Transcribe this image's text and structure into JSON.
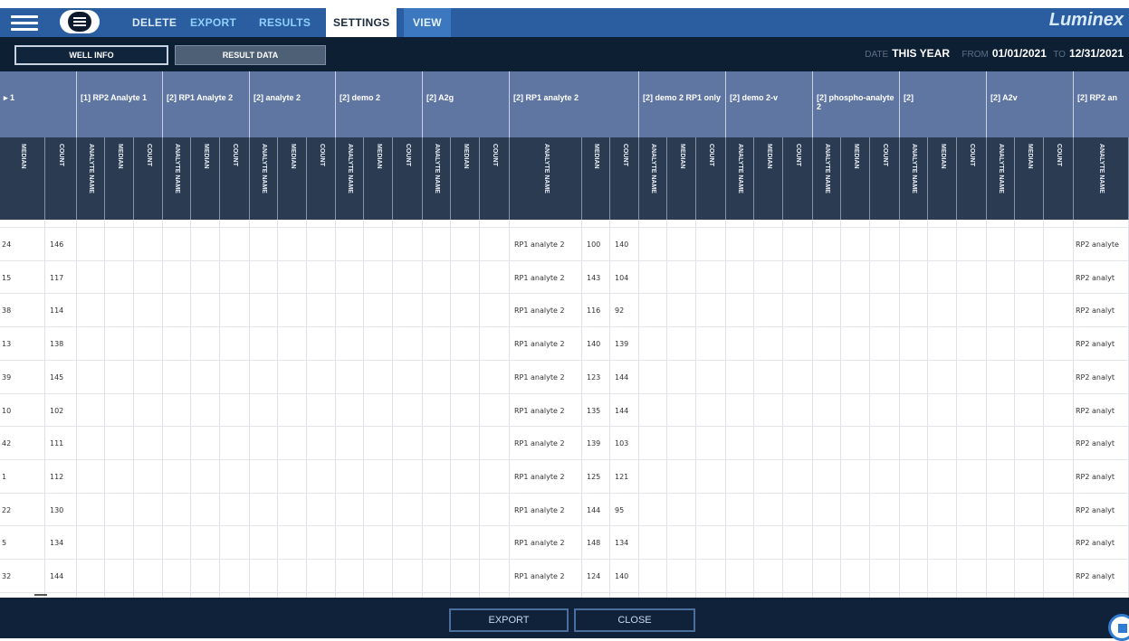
{
  "header_text": "",
  "nav": {
    "delete": "DELETE",
    "export": "EXPORT",
    "results": "RESULTS",
    "settings": "SETTINGS",
    "view": "VIEW"
  },
  "brand": "Luminex",
  "subnav": {
    "well_info": "WELL INFO",
    "result_data": "RESULT DATA"
  },
  "date": {
    "label": "DATE",
    "value": "THIS YEAR",
    "from_label": "FROM",
    "from": "01/01/2021",
    "to_label": "TO",
    "to": "12/31/2021"
  },
  "table": {
    "groups": [
      "▸ 1",
      "[1] RP2 Analyte 1",
      "[2] RP1 Analyte 2",
      "[2] analyte 2",
      "[2] demo 2",
      "[2] A2g",
      "[2] RP1 analyte 2",
      "[2] demo 2 RP1 only",
      "[2] demo 2-v",
      "[2] phospho-analyte 2",
      "[2]",
      "[2] A2v",
      "[2] RP2 an"
    ],
    "col_names": {
      "median": "MEDIAN",
      "count": "COUNT",
      "analyte": "ANALYTE NAME"
    },
    "rows": [
      {
        "median": "24",
        "count": "146",
        "rp1_name": "RP1 analyte 2",
        "rp1_median": "100",
        "rp1_count": "140",
        "rp2_name": "RP2 analyte"
      },
      {
        "median": "15",
        "count": "117",
        "rp1_name": "RP1 analyte 2",
        "rp1_median": "143",
        "rp1_count": "104",
        "rp2_name": "RP2 analyt"
      },
      {
        "median": "38",
        "count": "114",
        "rp1_name": "RP1 analyte 2",
        "rp1_median": "116",
        "rp1_count": "92",
        "rp2_name": "RP2 analyt"
      },
      {
        "median": "13",
        "count": "138",
        "rp1_name": "RP1 analyte 2",
        "rp1_median": "140",
        "rp1_count": "139",
        "rp2_name": "RP2 analyt"
      },
      {
        "median": "39",
        "count": "145",
        "rp1_name": "RP1 analyte 2",
        "rp1_median": "123",
        "rp1_count": "144",
        "rp2_name": "RP2 analyt"
      },
      {
        "median": "10",
        "count": "102",
        "rp1_name": "RP1 analyte 2",
        "rp1_median": "135",
        "rp1_count": "144",
        "rp2_name": "RP2 analyt"
      },
      {
        "median": "42",
        "count": "111",
        "rp1_name": "RP1 analyte 2",
        "rp1_median": "139",
        "rp1_count": "103",
        "rp2_name": "RP2 analyt"
      },
      {
        "median": "1",
        "count": "112",
        "rp1_name": "RP1 analyte 2",
        "rp1_median": "125",
        "rp1_count": "121",
        "rp2_name": "RP2 analyt"
      },
      {
        "median": "22",
        "count": "130",
        "rp1_name": "RP1 analyte 2",
        "rp1_median": "144",
        "rp1_count": "95",
        "rp2_name": "RP2 analyt"
      },
      {
        "median": "5",
        "count": "134",
        "rp1_name": "RP1 analyte 2",
        "rp1_median": "148",
        "rp1_count": "134",
        "rp2_name": "RP2 analyt"
      },
      {
        "median": "32",
        "count": "144",
        "rp1_name": "RP1 analyte 2",
        "rp1_median": "124",
        "rp1_count": "140",
        "rp2_name": "RP2 analyt"
      }
    ]
  },
  "footer": {
    "export": "EXPORT",
    "close": "CLOSE"
  }
}
